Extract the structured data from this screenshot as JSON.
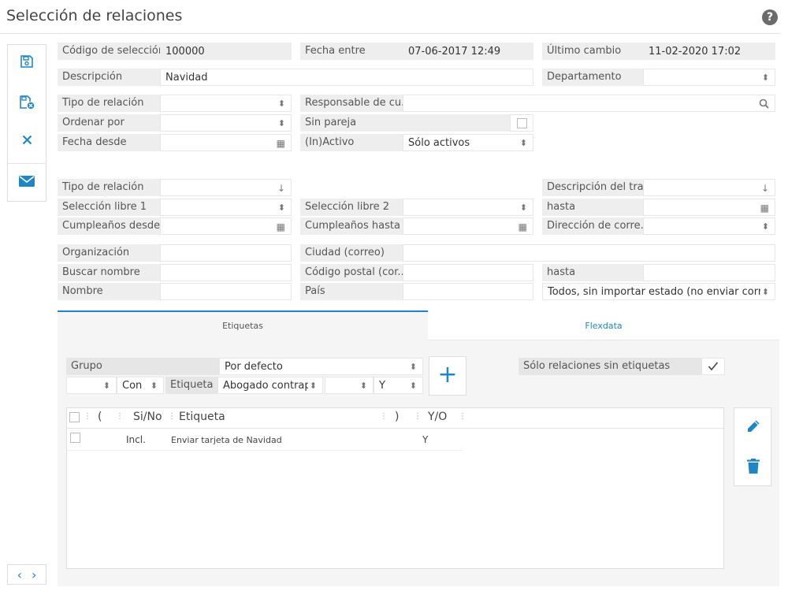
{
  "header": {
    "title": "Selección de relaciones",
    "help_icon": "?"
  },
  "toolbar": {
    "icons": [
      "save-icon",
      "save-delete-icon",
      "close-icon",
      "mail-icon"
    ]
  },
  "nav": {
    "prev": "‹",
    "next": "›"
  },
  "form": {
    "codigo_label": "Código de selección",
    "codigo_value": "100000",
    "fecha_entre_label": "Fecha entre",
    "fecha_entre_value": "07-06-2017 12:49",
    "ultimo_cambio_label": "Último cambio",
    "ultimo_cambio_value": "11-02-2020 17:02",
    "descripcion_label": "Descripción",
    "descripcion_value": "Navidad",
    "departamento_label": "Departamento",
    "departamento_value": "",
    "tipo_relacion_label": "Tipo de relación",
    "tipo_relacion_value": "",
    "responsable_label": "Responsable de cu...",
    "responsable_value": "",
    "ordenar_label": "Ordenar por",
    "ordenar_value": "",
    "sin_pareja_label": "Sin pareja",
    "fecha_desde_label": "Fecha desde",
    "fecha_desde_value": "",
    "inactivo_label": "(In)Activo",
    "inactivo_value": "Sólo activos",
    "tipo_relacion2_label": "Tipo de relación",
    "tipo_relacion2_value": "",
    "desc_trabajo_label": "Descripción del trabaj",
    "desc_trabajo_value": "",
    "sel_libre1_label": "Selección libre 1",
    "sel_libre1_value": "",
    "sel_libre2_label": "Selección libre 2",
    "sel_libre2_value": "",
    "hasta1_label": "hasta",
    "hasta1_value": "",
    "cumple_desde_label": "Cumpleaños desde",
    "cumple_desde_value": "",
    "cumple_hasta_label": "Cumpleaños hasta",
    "cumple_hasta_value": "",
    "direccion_label": "Dirección de corre...",
    "direccion_value": "",
    "organizacion_label": "Organización",
    "organizacion_value": "",
    "ciudad_label": "Ciudad (correo)",
    "ciudad_value": "",
    "buscar_label": "Buscar nombre",
    "buscar_value": "",
    "cp_label": "Código postal (cor...",
    "cp_value": "",
    "hasta2_label": "hasta",
    "hasta2_value": "",
    "nombre_label": "Nombre",
    "nombre_value": "",
    "pais_label": "País",
    "pais_value": "",
    "estado_value": "Todos, sin importar estado (no enviar corre"
  },
  "tabs": [
    {
      "label": "Etiquetas"
    },
    {
      "label": "Flexdata"
    }
  ],
  "etiquetas": {
    "grupo_label": "Grupo",
    "grupo_value": "Por defecto",
    "sin_etiquetas_label": "Sólo relaciones sin etiquetas",
    "row2": {
      "sel1": "",
      "con": "Con",
      "etiqueta_label": "Etiqueta",
      "etiqueta_value": "Abogado contrap",
      "sel2": "",
      "y": "Y"
    },
    "add_icon": "+",
    "grid": {
      "headers": [
        "(",
        "Si/No",
        "Etiqueta",
        ")",
        "Y/O"
      ],
      "rows": [
        {
          "paren_open": "",
          "sino": "Incl.",
          "etiqueta": "Enviar tarjeta de Navidad",
          "paren_close": "",
          "yo": "Y"
        }
      ]
    }
  }
}
